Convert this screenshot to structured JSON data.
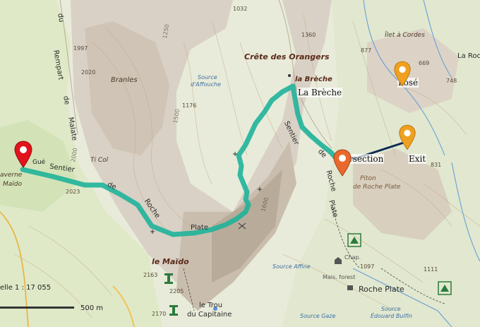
{
  "map": {
    "scale_text": "elle 1 : 17 055",
    "scale_bar_label": "500 m",
    "colors": {
      "route": "#1fb39a",
      "direct_line": "#0d2a55",
      "pin_start": "#e1131b",
      "pin_current": "#e9692c",
      "pin_waypoint": "#f0a020"
    }
  },
  "waypoints": {
    "start_label": "Gué",
    "la_breche": "La Brèche",
    "intersection": "rsection",
    "exit": "Exit",
    "pose": "Posé"
  },
  "labels": {
    "crete": "Crête des Orangers",
    "la_breche_map": "la Brèche",
    "branles": "Branles",
    "le_maido": "le Maïdo",
    "roche_plate": "Roche Plate",
    "trou": "le Trou",
    "capitaine": "du Capitaine",
    "ti_col": "Ti Col",
    "caverne": "averne",
    "maido": "Maïdo",
    "piton": "Piton",
    "de_roche_plate": "de Roche Plate",
    "ilet": "Îlet à Cordes",
    "la_roc": "La Roc",
    "mais_forest": "Mais. forest",
    "chap": "Chap.",
    "source_affouche": "Source",
    "source_affouche2": "d'Affouche",
    "source_affine": "Source Affine",
    "source_gaze": "Source Gaze",
    "source_edouard": "Source",
    "source_edouard2": "Édouard Bulfin",
    "rempart": [
      "Rempart",
      "du",
      "de",
      "Malate"
    ],
    "trail_left": [
      "Sentier",
      "de",
      "Roche",
      "Plate"
    ],
    "trail_right": [
      "Sentier",
      "de",
      "Roche",
      "Plate"
    ]
  },
  "elevations": {
    "e1997": "1997",
    "e2020": "2020",
    "e1032": "1032",
    "e1360": "1360",
    "e877": "877",
    "e669": "669",
    "e748": "748",
    "e1176": "1176",
    "e2023": "2023",
    "e2163": "2163",
    "e2205": "2205",
    "e2170": "2170",
    "e1097": "1097",
    "e1111": "1111",
    "e831": "831",
    "e1": "1250",
    "e2": "1500",
    "e3": "2000",
    "e4": "1600"
  }
}
